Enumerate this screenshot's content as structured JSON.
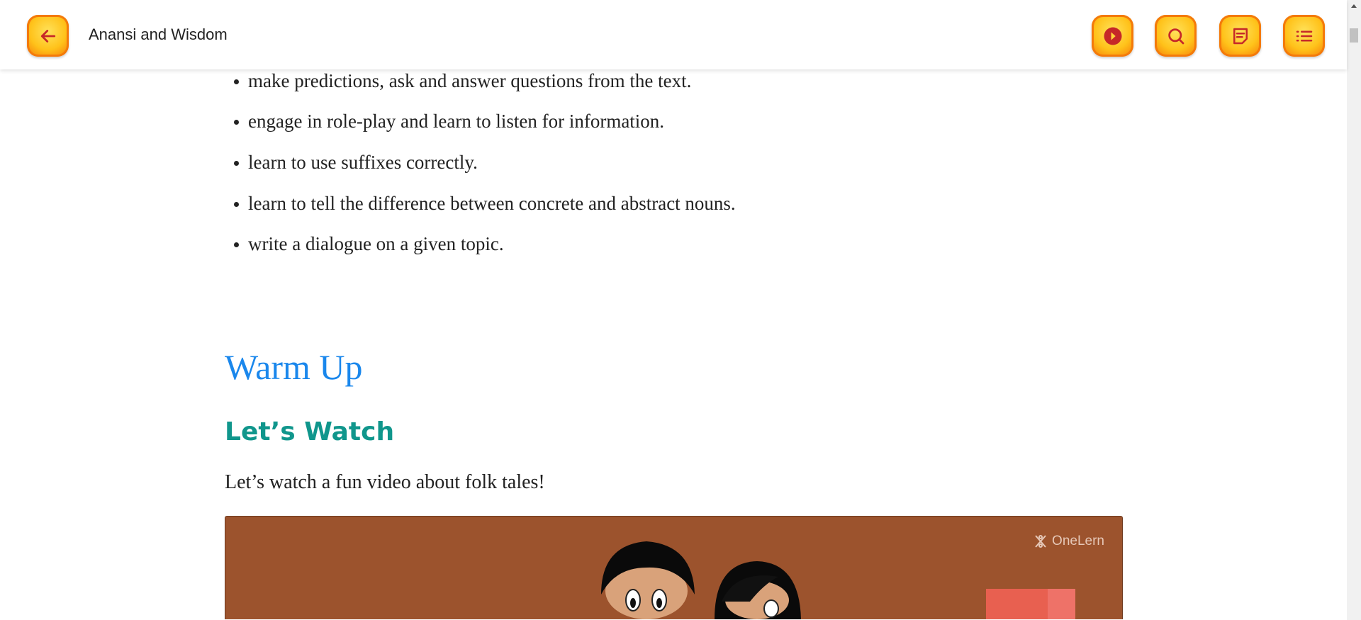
{
  "header": {
    "title": "Anansi and Wisdom",
    "buttons": [
      {
        "name": "back",
        "icon": "arrow-left-icon"
      },
      {
        "name": "play",
        "icon": "play-circle-icon"
      },
      {
        "name": "search",
        "icon": "search-icon"
      },
      {
        "name": "notes",
        "icon": "note-icon"
      },
      {
        "name": "contents",
        "icon": "list-icon"
      }
    ]
  },
  "content": {
    "bullets": [
      "make predictions, ask and answer questions from the text.",
      "engage in role-play and learn to listen for information.",
      "learn to use suffixes correctly.",
      "learn to tell the difference between concrete and abstract nouns.",
      "write a dialogue on a given topic."
    ],
    "section_title": "Warm Up",
    "subsection_title": "Let’s Watch",
    "intro": "Let’s watch a fun video about folk tales!",
    "video": {
      "watermark": "OneLern"
    }
  },
  "colors": {
    "accent": "#ffc21a",
    "heading": "#1a87ec",
    "subheading": "#10968c",
    "video_bg": "#9c532d"
  }
}
